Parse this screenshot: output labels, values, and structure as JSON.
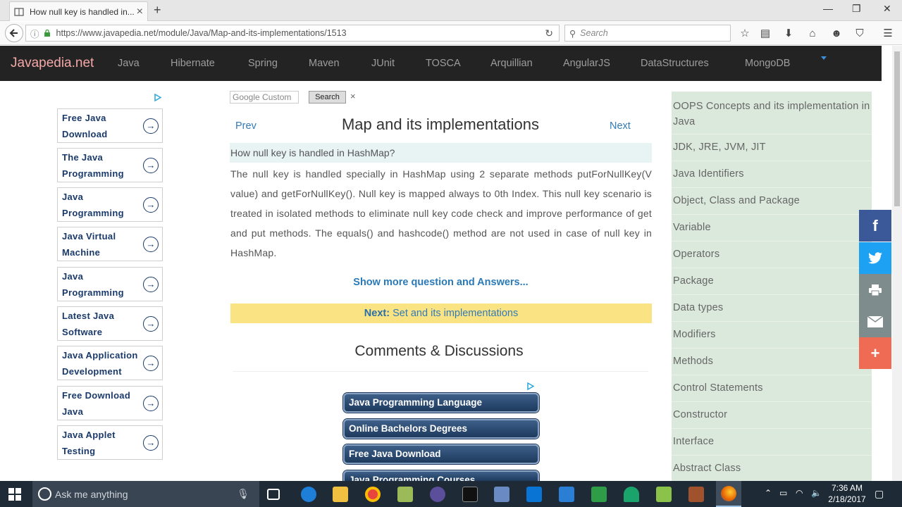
{
  "browser": {
    "tab_title": "How null key is handled in...",
    "tab_close": "×",
    "new_tab": "+",
    "url": "https://www.javapedia.net/module/Java/Map-and-its-implementations/1513",
    "search_placeholder": "Search",
    "window_min": "—",
    "window_max": "❐",
    "window_close": "✕"
  },
  "site": {
    "brand": "Javapedia.net",
    "nav": [
      "Java",
      "Hibernate",
      "Spring",
      "Maven",
      "JUnit",
      "TOSCA",
      "Arquillian",
      "AngularJS",
      "DataStructures",
      "MongoDB"
    ]
  },
  "left_ads": [
    {
      "line1": "Free Java",
      "line2": "Download"
    },
    {
      "line1": "The Java",
      "line2": "Programming"
    },
    {
      "line1": "Java",
      "line2": "Programming"
    },
    {
      "line1": "Java Virtual",
      "line2": "Machine"
    },
    {
      "line1": "Java",
      "line2": "Programming"
    },
    {
      "line1": "Latest Java",
      "line2": "Software"
    },
    {
      "line1": "Java Application",
      "line2": "Development"
    },
    {
      "line1": "Free Download",
      "line2": "Java"
    },
    {
      "line1": "Java Applet",
      "line2": "Testing"
    }
  ],
  "google_search": {
    "placeholder": "Google  Custom",
    "button": "Search",
    "close": "×"
  },
  "main": {
    "prev": "Prev",
    "next": "Next",
    "title": "Map and its implementations",
    "question": "How null key is handled in HashMap?",
    "answer": "The null key is handled specially in HashMap using 2 separate methods putForNullKey(V value) and getForNullKey(). Null key is mapped always to 0th Index. This null key scenario is treated in isolated methods to eliminate null key code check and improve performance of get and put methods. The equals() and hashcode() method are not used in case of null key in HashMap.",
    "show_more": "Show more question and Answers...",
    "next_label": "Next:",
    "next_link": "Set and its implementations",
    "comments_heading": "Comments & Discussions"
  },
  "bottom_ads": [
    "Java Programming Language",
    "Online Bachelors Degrees",
    "Free Java Download",
    "Java Programming Courses"
  ],
  "right_menu": [
    "OOPS Concepts and its implementation in Java",
    "JDK, JRE, JVM, JIT",
    "Java Identifiers",
    "Object, Class and Package",
    "Variable",
    "Operators",
    "Package",
    "Data types",
    "Modifiers",
    "Methods",
    "Control Statements",
    "Constructor",
    "Interface",
    "Abstract Class"
  ],
  "share": {
    "facebook": "f",
    "plus": "+",
    "colors": {
      "facebook": "#3b5998",
      "twitter": "#1da1f2",
      "print": "#7f8c8d",
      "email": "#7f8c8d",
      "more": "#f06b54"
    }
  },
  "taskbar": {
    "cortana": "Ask me anything",
    "time": "7:36 AM",
    "date": "2/18/2017"
  }
}
